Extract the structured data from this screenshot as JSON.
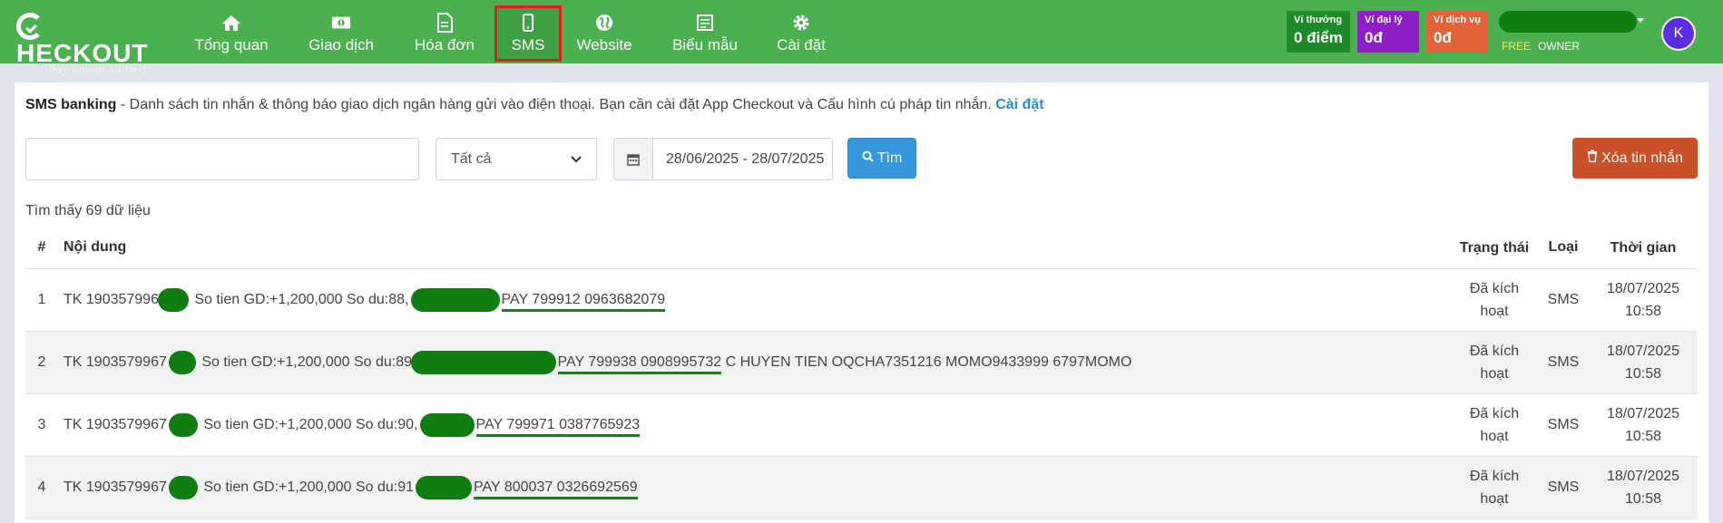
{
  "brand": {
    "name": "HECKOUT",
    "tagline": "Pay online All-IN-1"
  },
  "nav": [
    {
      "label": "Tổng quan",
      "icon": "home-icon"
    },
    {
      "label": "Giao dịch",
      "icon": "money-icon"
    },
    {
      "label": "Hóa đơn",
      "icon": "invoice-icon"
    },
    {
      "label": "SMS",
      "icon": "phone-icon",
      "active": true
    },
    {
      "label": "Website",
      "icon": "globe-icon"
    },
    {
      "label": "Biểu mẫu",
      "icon": "form-icon"
    },
    {
      "label": "Cài đặt",
      "icon": "gear-icon"
    }
  ],
  "wallets": [
    {
      "label": "Ví thưởng",
      "value": "0 điểm",
      "color": "#1f8a2a"
    },
    {
      "label": "Ví đại lý",
      "value": "0đ",
      "color": "#8e1fc7"
    },
    {
      "label": "Ví dịch vụ",
      "value": "0đ",
      "color": "#e2623a"
    }
  ],
  "user": {
    "plan": "FREE",
    "role": "OWNER",
    "avatar_initial": "K"
  },
  "intro": {
    "title": "SMS banking",
    "text": " - Danh sách tin nhắn & thông báo giao dịch ngân hàng gửi vào điện thoại. Bạn cần cài đặt App Checkout và Cấu hình cú pháp tin nhắn. ",
    "link": "Cài đặt"
  },
  "filters": {
    "search_value": "",
    "select_value": "Tất cả",
    "date_range": "28/06/2025 - 28/07/2025",
    "search_button": "Tìm",
    "delete_button": "Xóa tin nhắn"
  },
  "result_count": "Tìm thấy 69 dữ liệu",
  "table": {
    "headers": {
      "num": "#",
      "content": "Nội dung",
      "status": "Trạng thái",
      "type": "Loại",
      "time": "Thời gian"
    },
    "rows": [
      {
        "num": "1",
        "prefix": "TK 1903579967",
        "middle": " So tien GD:+1,200,000 So du:88,",
        "pay": "PAY 799912 0963682079",
        "suffix": "",
        "status_1": "Đã kích",
        "status_2": "hoạt",
        "type": "SMS",
        "date": "18/07/2025",
        "time": "10:58"
      },
      {
        "num": "2",
        "prefix": "TK 1903579967",
        "middle": " So tien GD:+1,200,000 So du:89,",
        "pay": "PAY 799938 0908995732",
        "suffix": " C HUYEN TIEN OQCHA7351216 MOMO9433999 6797MOMO",
        "status_1": "Đã kích",
        "status_2": "hoạt",
        "type": "SMS",
        "date": "18/07/2025",
        "time": "10:58"
      },
      {
        "num": "3",
        "prefix": "TK 1903579967",
        "middle": " So tien GD:+1,200,000 So du:90,",
        "pay": "PAY 799971 0387765923",
        "suffix": "",
        "status_1": "Đã kích",
        "status_2": "hoạt",
        "type": "SMS",
        "date": "18/07/2025",
        "time": "10:58"
      },
      {
        "num": "4",
        "prefix": "TK 1903579967",
        "middle": " So tien GD:+1,200,000 So du:91",
        "pay": "PAY 800037 0326692569",
        "suffix": "",
        "status_1": "Đã kích",
        "status_2": "hoạt",
        "type": "SMS",
        "date": "18/07/2025",
        "time": "10:58"
      }
    ]
  }
}
